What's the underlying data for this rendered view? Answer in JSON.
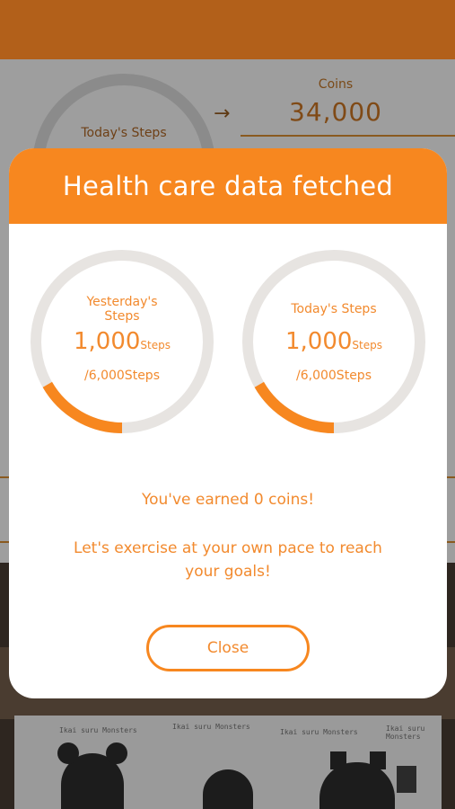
{
  "background": {
    "todays_steps_label": "Today's Steps",
    "coins_label": "Coins",
    "coins_value": "34,000",
    "poster_doodle_text": "Ikai\nsuru\nMonsters"
  },
  "modal": {
    "title": "Health care data fetched",
    "rings": [
      {
        "label_line1": "Yesterday's",
        "label_line2": "Steps",
        "value": "1,000",
        "unit": "Steps",
        "goal": "/6,000Steps",
        "progress": 0.1667
      },
      {
        "label_line1": "Today's Steps",
        "label_line2": "",
        "value": "1,000",
        "unit": "Steps",
        "goal": "/6,000Steps",
        "progress": 0.1667
      }
    ],
    "earned_text": "You've earned 0 coins!",
    "encourage_line1": "Let's exercise at your own pace to reach",
    "encourage_line2": "your goals!",
    "close_label": "Close"
  },
  "colors": {
    "accent": "#f7871f",
    "text_accent": "#f28a2e",
    "ring_track": "#e7e4e1"
  }
}
